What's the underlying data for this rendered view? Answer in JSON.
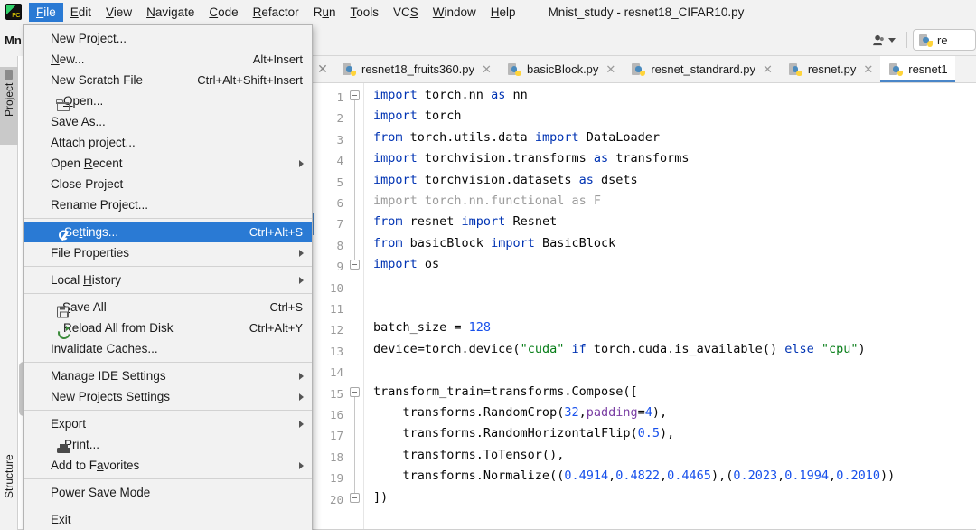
{
  "window": {
    "title": "Mnist_study - resnet18_CIFAR10.py",
    "logo_icon": "pycharm-logo-icon"
  },
  "menubar": {
    "items": [
      {
        "label": "File",
        "mnemonic": "F",
        "active": true
      },
      {
        "label": "Edit",
        "mnemonic": "E",
        "active": false
      },
      {
        "label": "View",
        "mnemonic": "V",
        "active": false
      },
      {
        "label": "Navigate",
        "mnemonic": "N",
        "active": false
      },
      {
        "label": "Code",
        "mnemonic": "C",
        "active": false
      },
      {
        "label": "Refactor",
        "mnemonic": "R",
        "active": false
      },
      {
        "label": "Run",
        "mnemonic": "u",
        "active": false
      },
      {
        "label": "Tools",
        "mnemonic": "T",
        "active": false
      },
      {
        "label": "VCS",
        "mnemonic": "S",
        "active": false
      },
      {
        "label": "Window",
        "mnemonic": "W",
        "active": false
      },
      {
        "label": "Help",
        "mnemonic": "H",
        "active": false
      }
    ]
  },
  "file_menu": {
    "items": [
      {
        "label": "New Project...",
        "shortcut": "",
        "icon": "",
        "submenu": false,
        "highlighted": false,
        "sep_after": false
      },
      {
        "label": "New...",
        "shortcut": "Alt+Insert",
        "icon": "",
        "submenu": false,
        "highlighted": false,
        "sep_after": false
      },
      {
        "label": "New Scratch File",
        "shortcut": "Ctrl+Alt+Shift+Insert",
        "icon": "",
        "submenu": false,
        "highlighted": false,
        "sep_after": false
      },
      {
        "label": "Open...",
        "shortcut": "",
        "icon": "folder-icon",
        "submenu": false,
        "highlighted": false,
        "sep_after": false
      },
      {
        "label": "Save As...",
        "shortcut": "",
        "icon": "",
        "submenu": false,
        "highlighted": false,
        "sep_after": false
      },
      {
        "label": "Attach project...",
        "shortcut": "",
        "icon": "",
        "submenu": false,
        "highlighted": false,
        "sep_after": false
      },
      {
        "label": "Open Recent",
        "shortcut": "",
        "icon": "",
        "submenu": true,
        "highlighted": false,
        "sep_after": false
      },
      {
        "label": "Close Project",
        "shortcut": "",
        "icon": "",
        "submenu": false,
        "highlighted": false,
        "sep_after": false
      },
      {
        "label": "Rename Project...",
        "shortcut": "",
        "icon": "",
        "submenu": false,
        "highlighted": false,
        "sep_after": true
      },
      {
        "label": "Settings...",
        "shortcut": "Ctrl+Alt+S",
        "icon": "wrench-icon",
        "submenu": false,
        "highlighted": true,
        "sep_after": false
      },
      {
        "label": "File Properties",
        "shortcut": "",
        "icon": "",
        "submenu": true,
        "highlighted": false,
        "sep_after": true
      },
      {
        "label": "Local History",
        "shortcut": "",
        "icon": "",
        "submenu": true,
        "highlighted": false,
        "sep_after": true
      },
      {
        "label": "Save All",
        "shortcut": "Ctrl+S",
        "icon": "save-icon",
        "submenu": false,
        "highlighted": false,
        "sep_after": false
      },
      {
        "label": "Reload All from Disk",
        "shortcut": "Ctrl+Alt+Y",
        "icon": "reload-icon",
        "submenu": false,
        "highlighted": false,
        "sep_after": false
      },
      {
        "label": "Invalidate Caches...",
        "shortcut": "",
        "icon": "",
        "submenu": false,
        "highlighted": false,
        "sep_after": true
      },
      {
        "label": "Manage IDE Settings",
        "shortcut": "",
        "icon": "",
        "submenu": true,
        "highlighted": false,
        "sep_after": false
      },
      {
        "label": "New Projects Settings",
        "shortcut": "",
        "icon": "",
        "submenu": true,
        "highlighted": false,
        "sep_after": true
      },
      {
        "label": "Export",
        "shortcut": "",
        "icon": "",
        "submenu": true,
        "highlighted": false,
        "sep_after": false
      },
      {
        "label": "Print...",
        "shortcut": "",
        "icon": "print-icon",
        "submenu": false,
        "highlighted": false,
        "sep_after": false
      },
      {
        "label": "Add to Favorites",
        "shortcut": "",
        "icon": "",
        "submenu": true,
        "highlighted": false,
        "sep_after": true
      },
      {
        "label": "Power Save Mode",
        "shortcut": "",
        "icon": "",
        "submenu": false,
        "highlighted": false,
        "sep_after": true
      },
      {
        "label": "Exit",
        "shortcut": "",
        "icon": "",
        "submenu": false,
        "highlighted": false,
        "sep_after": false
      }
    ],
    "mnemonics": {
      "New...": "N",
      "Open...": "O",
      "Open Recent": "R",
      "Settings...": "t",
      "Local History": "H",
      "Save All": "S",
      "Print...": "P",
      "Add to Favorites": "a",
      "Exit": "x"
    }
  },
  "toolbar": {
    "project_header": "Mn",
    "avatar_icon": "user-account-icon",
    "avatar_dropdown_icon": "chevron-down-icon",
    "run_config_label": "re",
    "run_config_icon": "python-file-icon"
  },
  "left_tool_window": {
    "tabs": [
      {
        "label": "Project",
        "icon": "folder-icon",
        "selected": true
      },
      {
        "label": "Structure",
        "icon": "",
        "selected": false
      }
    ]
  },
  "editor": {
    "tabs": [
      {
        "label": "resnet18_fruits360.py",
        "icon": "python-file-icon",
        "active": false,
        "close_icon": "close-icon"
      },
      {
        "label": "basicBlock.py",
        "icon": "python-file-icon",
        "active": false,
        "close_icon": "close-icon"
      },
      {
        "label": "resnet_standrard.py",
        "icon": "python-file-icon",
        "active": false,
        "close_icon": "close-icon"
      },
      {
        "label": "resnet.py",
        "icon": "python-file-icon",
        "active": false,
        "close_icon": "close-icon"
      },
      {
        "label": "resnet1",
        "icon": "python-file-icon",
        "active": true,
        "close_icon": ""
      }
    ],
    "line_numbers": [
      1,
      2,
      3,
      4,
      5,
      6,
      7,
      8,
      9,
      10,
      11,
      12,
      13,
      14,
      15,
      16,
      17,
      18,
      19,
      20
    ],
    "code_lines": [
      {
        "n": 1,
        "text": "import torch.nn as nn"
      },
      {
        "n": 2,
        "text": "import torch"
      },
      {
        "n": 3,
        "text": "from torch.utils.data import DataLoader"
      },
      {
        "n": 4,
        "text": "import torchvision.transforms as transforms"
      },
      {
        "n": 5,
        "text": "import torchvision.datasets as dsets"
      },
      {
        "n": 6,
        "text": "import torch.nn.functional as F"
      },
      {
        "n": 7,
        "text": "from resnet import Resnet"
      },
      {
        "n": 8,
        "text": "from basicBlock import BasicBlock"
      },
      {
        "n": 9,
        "text": "import os"
      },
      {
        "n": 10,
        "text": ""
      },
      {
        "n": 11,
        "text": ""
      },
      {
        "n": 12,
        "text": "batch_size = 128"
      },
      {
        "n": 13,
        "text": "device=torch.device(\"cuda\" if torch.cuda.is_available() else \"cpu\")"
      },
      {
        "n": 14,
        "text": ""
      },
      {
        "n": 15,
        "text": "transform_train=transforms.Compose(["
      },
      {
        "n": 16,
        "text": "    transforms.RandomCrop(32,padding=4),"
      },
      {
        "n": 17,
        "text": "    transforms.RandomHorizontalFlip(0.5),"
      },
      {
        "n": 18,
        "text": "    transforms.ToTensor(),"
      },
      {
        "n": 19,
        "text": "    transforms.Normalize((0.4914,0.4822,0.4465),(0.2023,0.1994,0.2010))"
      },
      {
        "n": 20,
        "text": "])"
      }
    ]
  },
  "colors": {
    "menu_highlight": "#2a7ad4",
    "keyword": "#0033b3",
    "number": "#1750eb",
    "string": "#067d17",
    "kwarg": "#7a3ea3",
    "unused_import": "#9b9b9b",
    "active_tab_underline": "#4a86c8",
    "chrome_bg": "#f2f2f2",
    "editor_bg": "#ffffff"
  }
}
